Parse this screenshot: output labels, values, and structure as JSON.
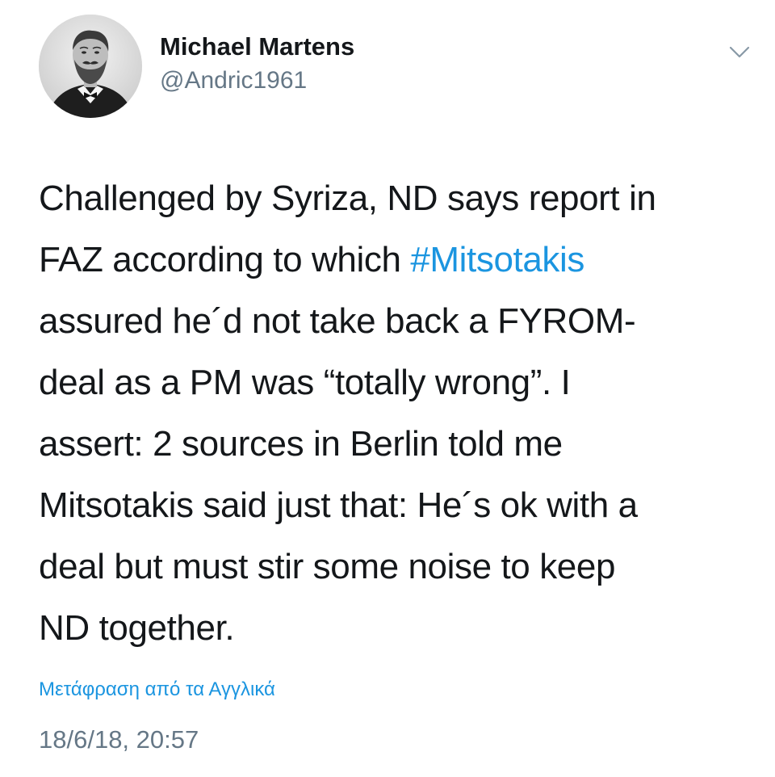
{
  "author": {
    "display_name": "Michael Martens",
    "handle": "@Andric1961",
    "avatar_icon": "portrait-avatar-icon"
  },
  "menu": {
    "icon": "chevron-down-icon"
  },
  "tweet": {
    "lines": [
      {
        "pre": "Challenged by Syriza, ND says report in",
        "tag": "",
        "post": ""
      },
      {
        "pre": "FAZ according to which ",
        "tag": "#Mitsotakis",
        "post": ""
      },
      {
        "pre": "assured he´d not take back a FYROM-",
        "tag": "",
        "post": ""
      },
      {
        "pre": "deal as a PM was “totally wrong”. I",
        "tag": "",
        "post": ""
      },
      {
        "pre": "assert: 2 sources in Berlin told me",
        "tag": "",
        "post": ""
      },
      {
        "pre": "Mitsotakis said just that: He´s ok with a",
        "tag": "",
        "post": ""
      },
      {
        "pre": "deal but must stir some noise to keep",
        "tag": "",
        "post": ""
      },
      {
        "pre": "ND together.",
        "tag": "",
        "post": ""
      }
    ]
  },
  "translate_link": "Μετάφραση από τα Αγγλικά",
  "timestamp": "18/6/18, 20:57",
  "colors": {
    "text": "#14171a",
    "secondary": "#657786",
    "link": "#1b95e0"
  }
}
